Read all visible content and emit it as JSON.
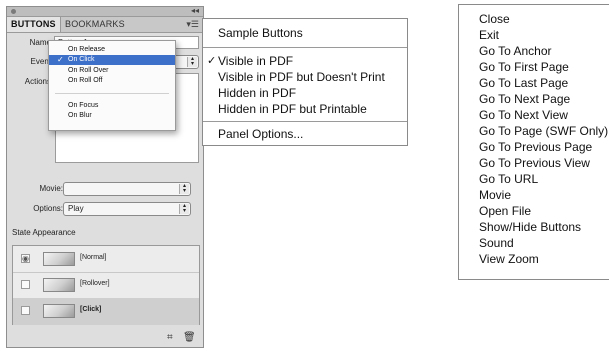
{
  "panel": {
    "tabs": [
      {
        "label": "BUTTONS"
      },
      {
        "label": "BOOKMARKS"
      }
    ],
    "collapse_glyph": "◂◂",
    "menu_glyph": "▾☰",
    "name_label": "Name",
    "name_value": "Button 1",
    "event_label": "Event",
    "actions_label": "Actions",
    "movie_label": "Movie:",
    "movie_value": "",
    "options_label": "Options:",
    "options_value": "Play",
    "state_appearance_title": "State Appearance",
    "states": [
      {
        "label": "[Normal]",
        "selected": false
      },
      {
        "label": "[Rollover]",
        "selected": false
      },
      {
        "label": "[Click]",
        "selected": true
      }
    ],
    "bottom_icons": [
      "convert-object-icon",
      "trash-icon"
    ]
  },
  "events_popup": {
    "items": [
      {
        "label": "On Release",
        "checked": false,
        "selected": false
      },
      {
        "label": "On Click",
        "checked": true,
        "selected": true
      },
      {
        "label": "On Roll Over",
        "checked": false,
        "selected": false
      },
      {
        "label": "On Roll Off",
        "checked": false,
        "selected": false
      },
      {
        "label": "On Focus",
        "checked": false,
        "selected": false
      },
      {
        "label": "On Blur",
        "checked": false,
        "selected": false
      }
    ]
  },
  "panel_menu": {
    "items": [
      {
        "label": "Sample Buttons",
        "checked": false
      },
      {
        "label": "Visible in PDF",
        "checked": true
      },
      {
        "label": "Visible in PDF but Doesn't Print",
        "checked": false
      },
      {
        "label": "Hidden in PDF",
        "checked": false
      },
      {
        "label": "Hidden in PDF but Printable",
        "checked": false
      },
      {
        "label": "Panel Options...",
        "checked": false
      }
    ]
  },
  "actions_menu": {
    "items": [
      "Close",
      "Exit",
      "Go To Anchor",
      "Go To First Page",
      "Go To Last Page",
      "Go To Next Page",
      "Go To Next View",
      "Go To Page (SWF Only)",
      "Go To Previous Page",
      "Go To Previous View",
      "Go To URL",
      "Movie",
      "Open File",
      "Show/Hide Buttons",
      "Sound",
      "View Zoom"
    ]
  },
  "colors": {
    "selection": "#3d70c9",
    "panel_bg": "#dedede"
  }
}
